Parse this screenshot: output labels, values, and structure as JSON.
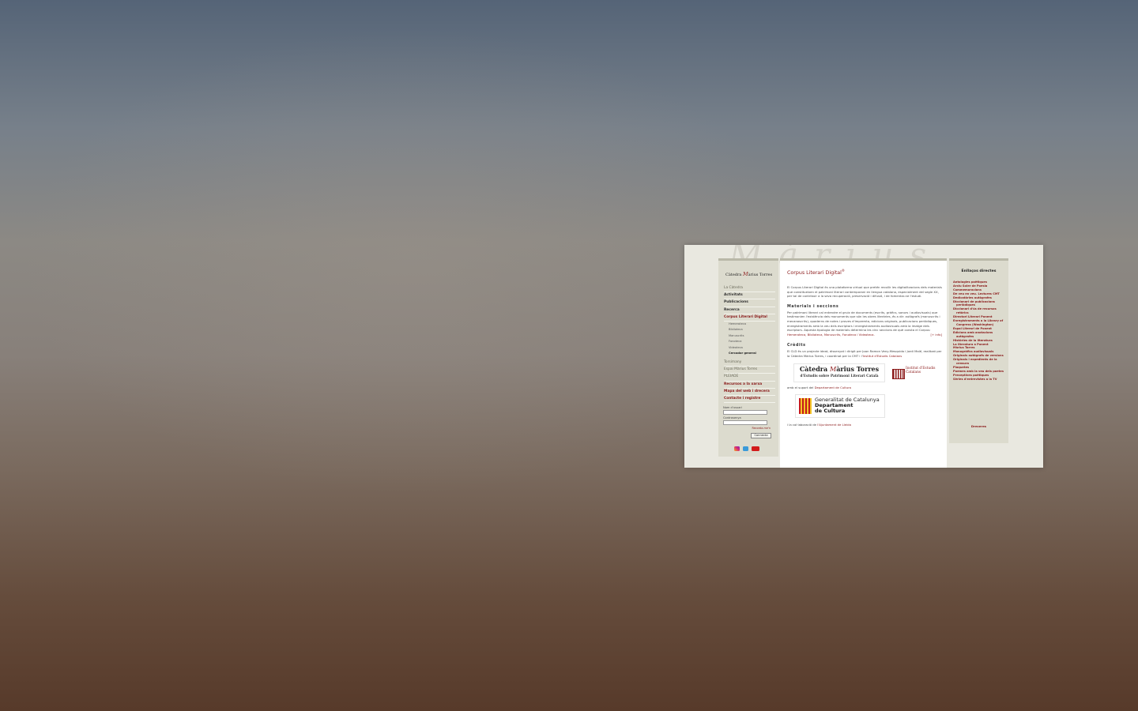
{
  "brand": {
    "part1": "Càtedra ",
    "m": "M",
    "part2": "àrius Torres"
  },
  "nav": {
    "la_catedra": "La Càtedra",
    "activitats": "Activitats",
    "publicacions": "Publicacions",
    "recerca": "Recerca",
    "corpus": "Corpus Literari Digital",
    "sub": [
      "Hemeroteca",
      "Biblioteca",
      "Manuscrits",
      "Fonoteca",
      "Videoteca",
      "Cercador general"
    ],
    "torsimany": "Torsimany",
    "espai": "Espai Màrius Torres",
    "pleiade": "PLEIADE",
    "recursos": "Recursos a la xarxa",
    "mapa": "Mapa del web i drecera",
    "contacte": "Contacte i registre"
  },
  "login": {
    "user_label": "Nom d'usuari",
    "pass_label": "Contrasenya",
    "forgot": "Recorda-me'n",
    "submit": "Connecta"
  },
  "main": {
    "title": "Corpus Literari Digital",
    "title_mark": "®",
    "intro_a": "El Corpus Literari Digital és una plataforma virtual que pretén recollir les digitalitzacions dels materials que constitueixen el patrimoni literari contemporani en llengua catalana, especialment del segle XX, per tal de contribuir a la seva recuperació, preservació i difusió, i de fomentar-ne l'estudi.",
    "h_materials": "Materials i seccions",
    "materials_a": "Per patrimoni literari cal entendre el gruix de documents (escrits, gràfics, sonors i audiovisuals) que testimonien l'existència dels monuments que són les obres literàries, és a dir: autògrafs (manuscrits i mecanoscrits), quaderns de notes i proves d'impremta, edicions originals, publicacions periòdiques, enregistraments amb la veu dels escriptors i enregistraments audiovisuals amb la imatge dels escriptors. Aquesta tipologia de materials determina les cinc seccions de què consta el Corpus: ",
    "materials_links": "Hemeroteca, Biblioteca, Manuscrits, Fonoteca i Videoteca.",
    "more": "[+ info]",
    "h_credits": "Crèdits",
    "credits_a": "El CLD és un projecte ideat, dissenyat i dirigit per Joan Ramon Veny-Mesquida i Jordi Malé, realitzat per la Càtedra Màrius Torres, i coordinat per la CMT i l'",
    "credits_link": "Institut d'Estudis Catalans",
    "logo_cmt_1": "Càtedra ",
    "logo_cmt_m": "M",
    "logo_cmt_2": "àrius Torres",
    "logo_cmt_sub": "d'Estudis sobre Patrimoni Literari Català",
    "logo_iec": "Institut d'Estudis Catalans",
    "support_a": "amb el suport del ",
    "support_link": "Departament de Cultura",
    "gen_1": "Generalitat de Catalunya",
    "gen_2": "Departament",
    "gen_3": "de Cultura",
    "collab_a": "i la col·laboració de ",
    "collab_link": "l'Ajuntament de Lleida"
  },
  "right": {
    "title": "Enllaços directes",
    "links": [
      "Antologies poètiques",
      "Arxiu Soler de Poesia",
      "Commemoracions",
      "De veu en veu. Lectures CMT",
      "Dedicatòries autògrafes",
      "Diccionari de publicacions periòdiques",
      "Diccionari d'ús de recursos retòrics",
      "Directori Literari Ponent",
      "Enregistraments a la Library of Congress (Washington)",
      "Espai Literari de Ponent",
      "Edicions amb anotacions autògrafes",
      "Històries de la literatura",
      "La literatura a Ponent",
      "Màrius Torres",
      "Monogràfics audiovisuals",
      "Originals autògrafs de versions",
      "Originals i expedients de la censura",
      "Plaquetes",
      "Poemes amb la veu dels poetes",
      "Preceptives poètiques",
      "Sèries d'entrevistes a la TV"
    ],
    "more": "Dreceres"
  }
}
